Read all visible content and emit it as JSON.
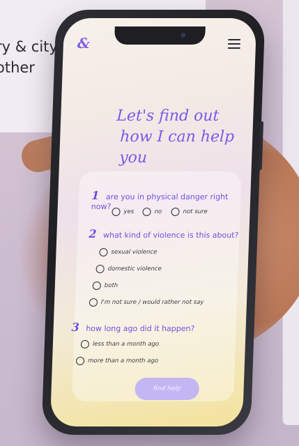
{
  "background": {
    "text_lines": [
      "ry & city of",
      "other"
    ]
  },
  "app": {
    "logo": "&",
    "headline": [
      "Let's find out",
      "how I can help you"
    ],
    "questions": [
      {
        "number": "1",
        "text": "are you in physical danger right now?",
        "options": [
          "yes",
          "no",
          "not sure"
        ]
      },
      {
        "number": "2",
        "text": "what kind of violence is this about?",
        "options": [
          "sexual violence",
          "domestic violence",
          "both",
          "I'm not sure / would rather not say"
        ]
      },
      {
        "number": "3",
        "text": "how long ago did it happen?",
        "options": [
          "less than a month ago",
          "more than a month ago"
        ]
      }
    ],
    "cta_label": "find help"
  },
  "colors": {
    "accent": "#7a5ae6",
    "button": "#c4b6f3"
  }
}
